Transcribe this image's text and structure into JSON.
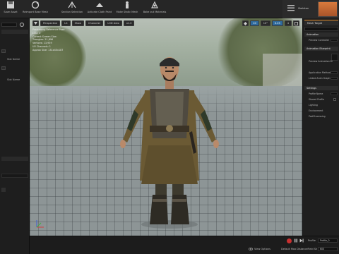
{
  "toolbar": {
    "items": [
      {
        "label": "Save Asset",
        "icon": "save-icon"
      },
      {
        "label": "Reimport Base Mesh",
        "icon": "reimport-icon"
      },
      {
        "label": "Section Selection",
        "icon": "section-selection-icon"
      },
      {
        "label": "Activate Cloth Paint",
        "icon": "cloth-paint-icon"
      },
      {
        "label": "Make Static Mesh",
        "icon": "static-mesh-icon"
      },
      {
        "label": "Bake out Materials",
        "icon": "bake-materials-icon"
      }
    ],
    "right_label": "Skeleton"
  },
  "viewport": {
    "perspective_label": "Perspective",
    "lit_label": "Lit",
    "show_label": "Show",
    "character_label": "Character",
    "lod_label": "LOD Auto",
    "speed_label": "x1.0",
    "right_tools": [
      "10",
      "10°",
      "0.25",
      "4"
    ],
    "stats": [
      "Previewing Reference Pose",
      "LOD: 0",
      "Current Screen Size:",
      "Triangles: 21,896",
      "Vertices: 13,939",
      "UV Channels: 1",
      "Approx Size: 131x40x187"
    ]
  },
  "left_panel": {
    "rows": [
      "Slot Name",
      "Slot Name"
    ]
  },
  "right_panel": {
    "tab": "Mesh Target",
    "sections": {
      "animation": "Animation",
      "animation_blueprint": "Animation Blueprint",
      "settings": "Settings"
    },
    "rows": {
      "preview_controller": "Preview Controller",
      "preview_anim_bp": "Preview Animation Bl",
      "application_method": "Application Method",
      "linked_anim_graph": "Linked Anim Graph Ta",
      "profile_name": "Profile Name",
      "shared_profile": "Shared Profile",
      "lighting": "Lighting",
      "environment": "Environment",
      "post_processing": "PostProcessing"
    }
  },
  "bottom_bar": {
    "view_options": "View Options",
    "profile_label": "Profile",
    "profile_value": "Profile_0",
    "default_max_label": "Default Max DistanceField Sh",
    "default_max_value": "600"
  },
  "colors": {
    "accent_orange": "#e08b2c",
    "record_red": "#c93030",
    "selected_blue": "#2f6a9d"
  }
}
